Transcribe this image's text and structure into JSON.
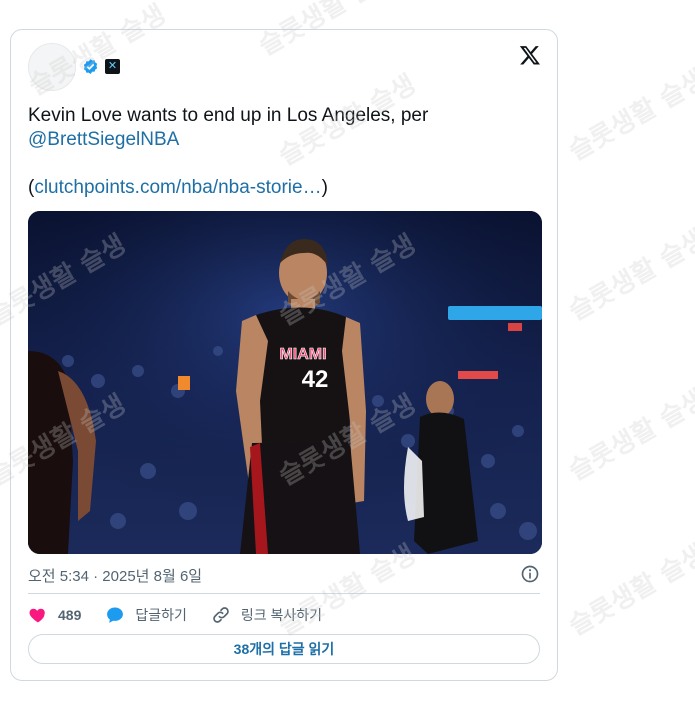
{
  "tweet": {
    "text_line1": "Kevin Love wants to end up in Los Angeles, per",
    "mention": "@BrettSiegelNBA",
    "link_open": "(",
    "link_text": "clutchpoints.com/nba/nba-storie…",
    "link_close": ")",
    "timestamp": "오전 5:34 · 2025년 8월 6일"
  },
  "jersey": {
    "team": "MIAMI",
    "number": "42"
  },
  "actions": {
    "like_count": "489",
    "reply_label": "답글하기",
    "copy_link_label": "링크 복사하기"
  },
  "read_replies": "38개의 답글 읽기",
  "watermark_text": "슬롯생활 슬생",
  "colors": {
    "link": "#1d6fa5",
    "like": "#f91880",
    "reply": "#1d9bf0",
    "verified": "#1d9bf0",
    "border": "#cfd9de",
    "muted": "#536471"
  },
  "icons": [
    "verified-badge-icon",
    "affiliate-badge-icon",
    "x-logo-icon",
    "info-icon",
    "heart-icon",
    "reply-bubble-icon",
    "link-icon"
  ]
}
